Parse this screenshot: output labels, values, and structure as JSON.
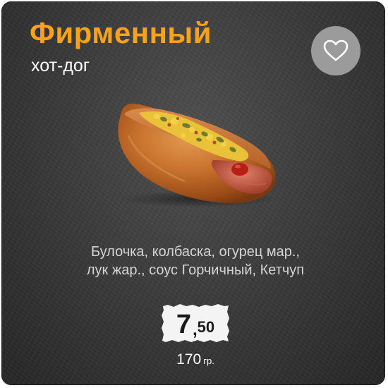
{
  "product": {
    "title": "Фирменный",
    "subtitle": "хот-дог",
    "ingredients_line1": "Булочка, колбаска, огурец мар.,",
    "ingredients_line2": "лук жар., соус Горчичный, Кетчуп",
    "price_integer": "7",
    "price_separator": ",",
    "price_decimal": "50",
    "weight_value": "170",
    "weight_unit": "гр."
  },
  "favorite": {
    "icon": "heart-icon"
  },
  "colors": {
    "title": "#f7a21a",
    "background": "#3c3c3c",
    "favorite_button": "#9b9b9b"
  }
}
